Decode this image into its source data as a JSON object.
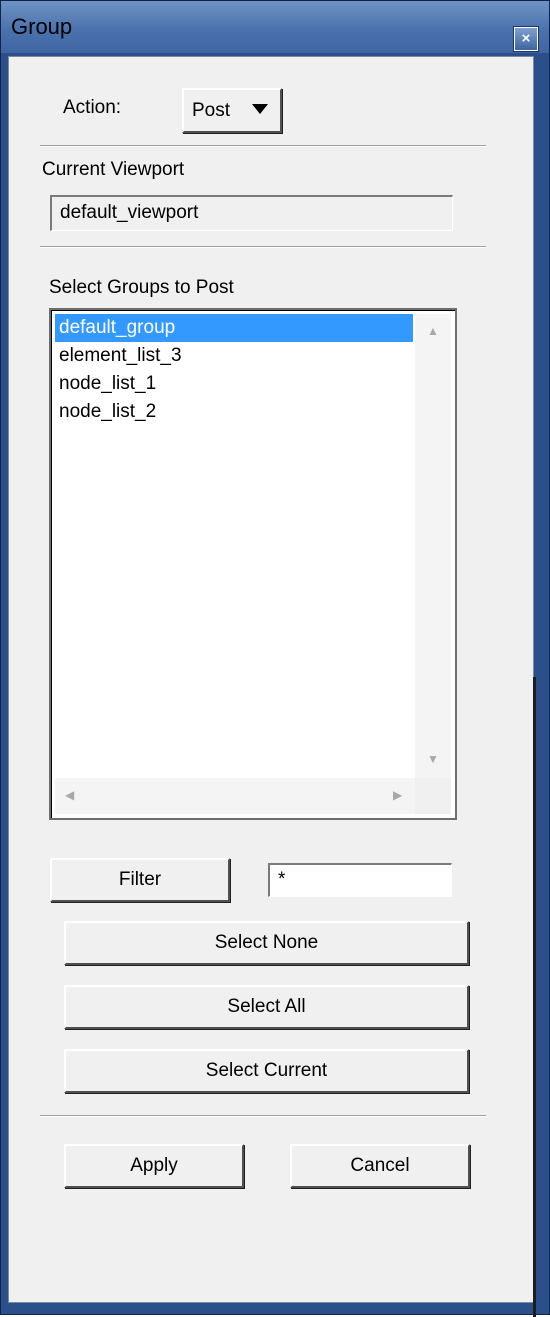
{
  "window": {
    "title": "Group",
    "close_glyph": "×"
  },
  "action": {
    "label": "Action:",
    "selected": "Post",
    "arrow_icon": "triangle-down-icon"
  },
  "viewport": {
    "label": "Current Viewport",
    "value": "default_viewport"
  },
  "groups": {
    "label": "Select Groups to Post",
    "items": [
      "default_group",
      "element_list_3",
      "node_list_1",
      "node_list_2"
    ],
    "selected_index": 0
  },
  "filter": {
    "button_label": "Filter",
    "value": "*"
  },
  "buttons": {
    "select_none": "Select None",
    "select_all": "Select All",
    "select_current": "Select Current",
    "apply": "Apply",
    "cancel": "Cancel"
  },
  "colors": {
    "title_bar": "#4a72ad",
    "selection": "#3399ff",
    "panel": "#f0f0f0"
  }
}
